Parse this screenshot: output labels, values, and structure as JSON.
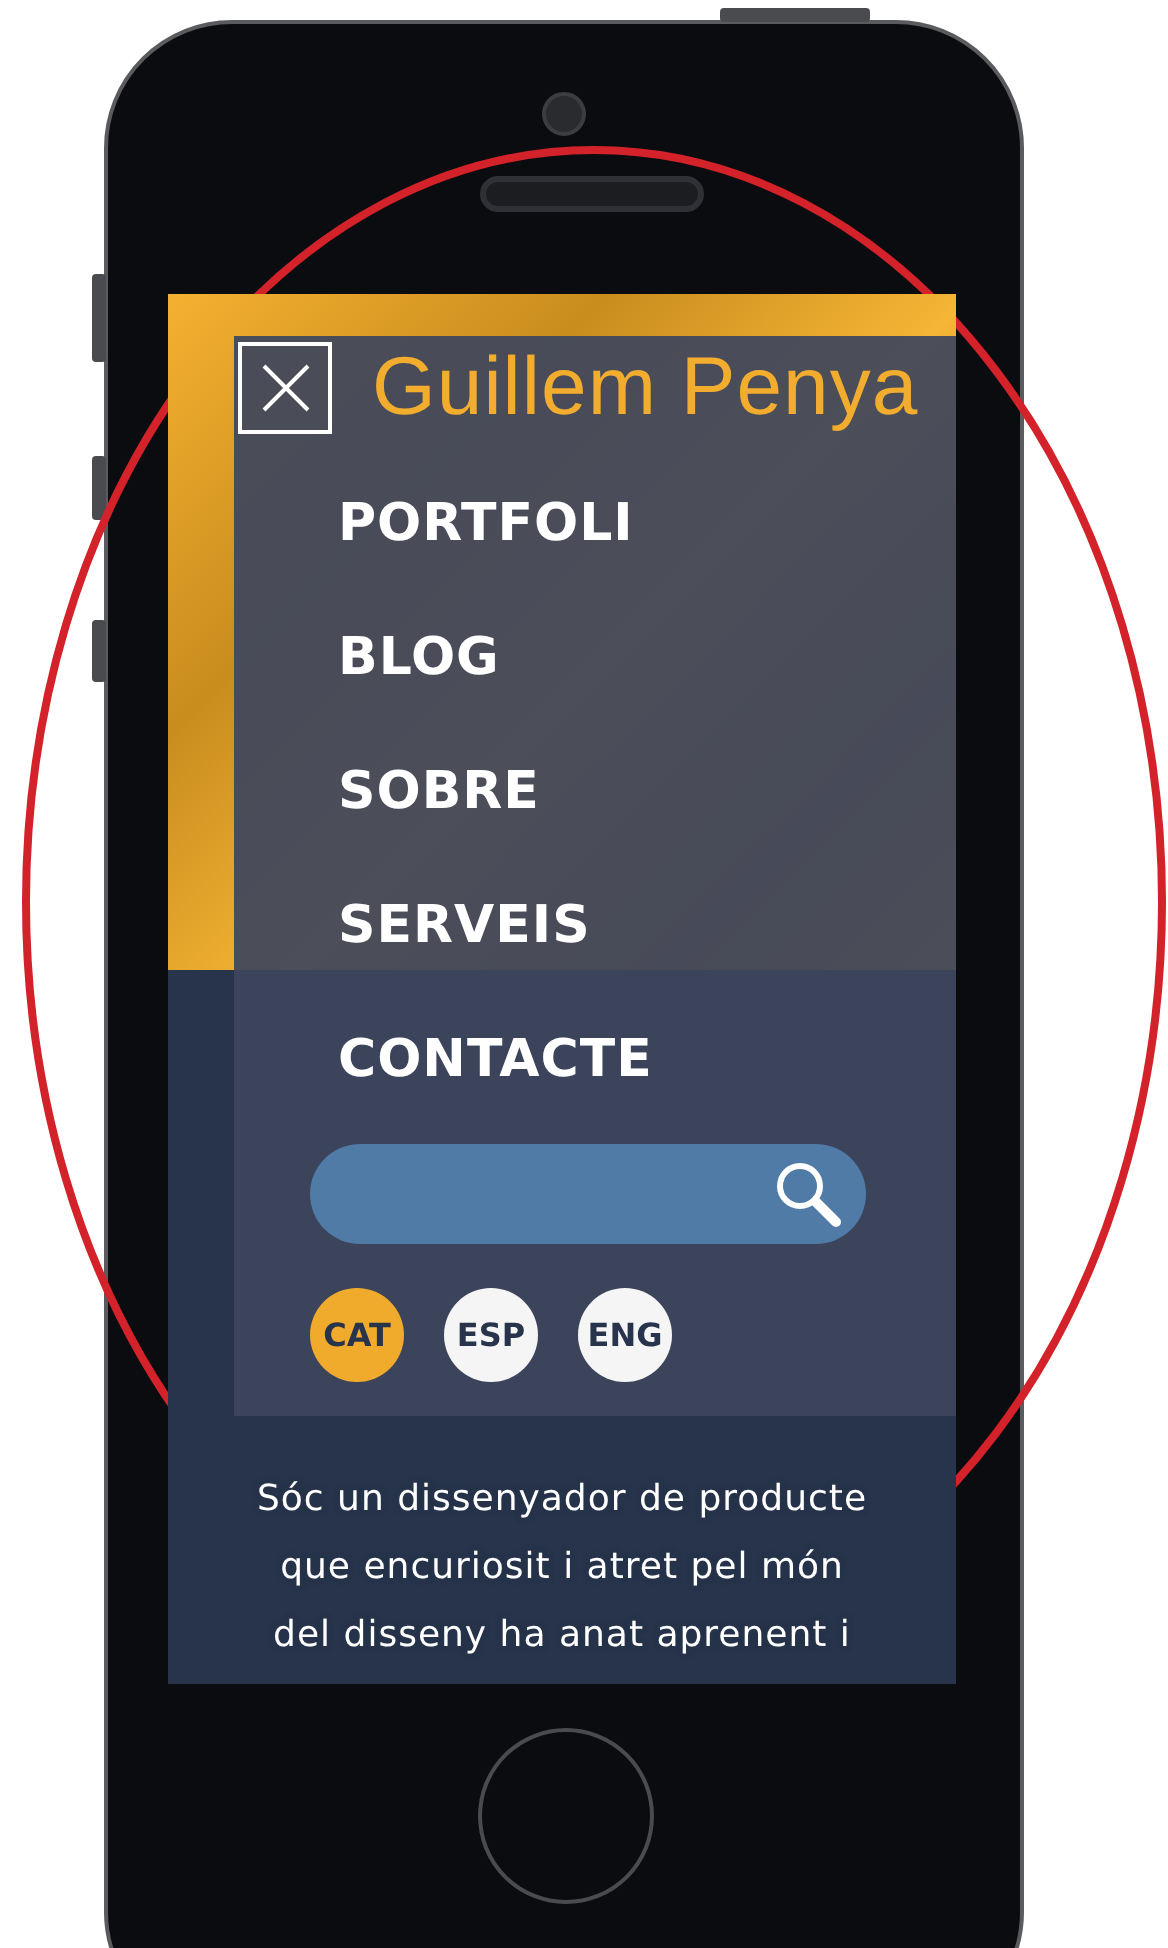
{
  "logo": "Guillem Penya",
  "menu": {
    "items": [
      {
        "label": "PORTFOLI"
      },
      {
        "label": "BLOG"
      },
      {
        "label": "SOBRE"
      },
      {
        "label": "SERVEIS"
      },
      {
        "label": "CONTACTE"
      }
    ]
  },
  "languages": [
    {
      "label": "CAT",
      "selected": true
    },
    {
      "label": "ESP",
      "selected": false
    },
    {
      "label": "ENG",
      "selected": false
    }
  ],
  "intro": "Sóc un dissenyador de producte que encuriosit i atret pel món del disseny ha anat aprenent i"
}
